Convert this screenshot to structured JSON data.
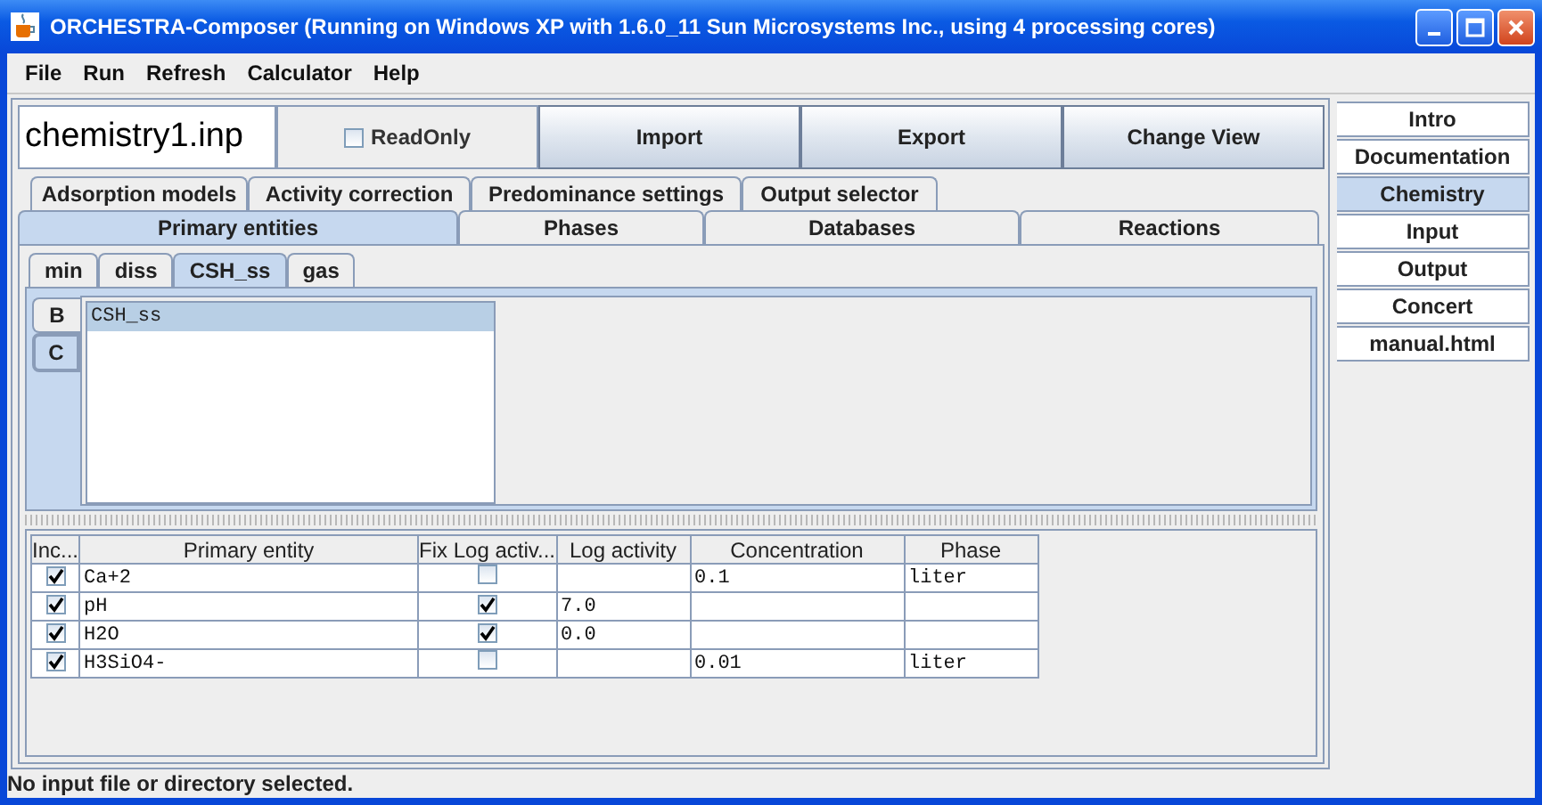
{
  "window": {
    "title": "ORCHESTRA-Composer (Running on Windows XP with 1.6.0_11  Sun Microsystems Inc., using 4 processing cores)"
  },
  "menu": [
    "File",
    "Run",
    "Refresh",
    "Calculator",
    "Help"
  ],
  "toolbar": {
    "file_name": "chemistry1.inp",
    "readonly": {
      "label": "ReadOnly",
      "checked": false
    },
    "buttons": [
      "Import",
      "Export",
      "Change View"
    ]
  },
  "tab_rows": [
    [
      {
        "label": "Adsorption models",
        "selected": false
      },
      {
        "label": "Activity correction",
        "selected": false
      },
      {
        "label": "Predominance settings",
        "selected": false
      },
      {
        "label": "Output selector",
        "selected": false
      }
    ],
    [
      {
        "label": "Primary entities",
        "selected": true
      },
      {
        "label": "Phases",
        "selected": false
      },
      {
        "label": "Databases",
        "selected": false
      },
      {
        "label": "Reactions",
        "selected": false
      }
    ]
  ],
  "sub_tabs": [
    {
      "label": "min",
      "selected": false
    },
    {
      "label": "diss",
      "selected": false
    },
    {
      "label": "CSH_ss",
      "selected": true
    },
    {
      "label": "gas",
      "selected": false
    }
  ],
  "vertical_tabs": [
    {
      "label": "B",
      "selected": false
    },
    {
      "label": "C",
      "selected": true
    }
  ],
  "list": [
    {
      "label": "CSH_ss",
      "selected": true
    }
  ],
  "table": {
    "columns": [
      "Inc...",
      "Primary entity",
      "Fix Log activ...",
      "Log activity",
      "Concentration",
      "Phase"
    ],
    "rows": [
      {
        "included": true,
        "entity": "Ca+2",
        "fixed": false,
        "log_activity": "",
        "concentration": "0.1",
        "phase": "liter"
      },
      {
        "included": true,
        "entity": "pH",
        "fixed": true,
        "log_activity": "7.0",
        "concentration": "",
        "phase": ""
      },
      {
        "included": true,
        "entity": "H2O",
        "fixed": true,
        "log_activity": "0.0",
        "concentration": "",
        "phase": ""
      },
      {
        "included": true,
        "entity": "H3SiO4-",
        "fixed": false,
        "log_activity": "",
        "concentration": "0.01",
        "phase": "liter"
      }
    ]
  },
  "side_tabs": [
    {
      "label": "Intro",
      "selected": false
    },
    {
      "label": "Documentation",
      "selected": false
    },
    {
      "label": "Chemistry",
      "selected": true
    },
    {
      "label": "Input",
      "selected": false
    },
    {
      "label": "Output",
      "selected": false
    },
    {
      "label": "Concert",
      "selected": false
    },
    {
      "label": "manual.html",
      "selected": false
    }
  ],
  "status_bar": "No input file or directory selected."
}
